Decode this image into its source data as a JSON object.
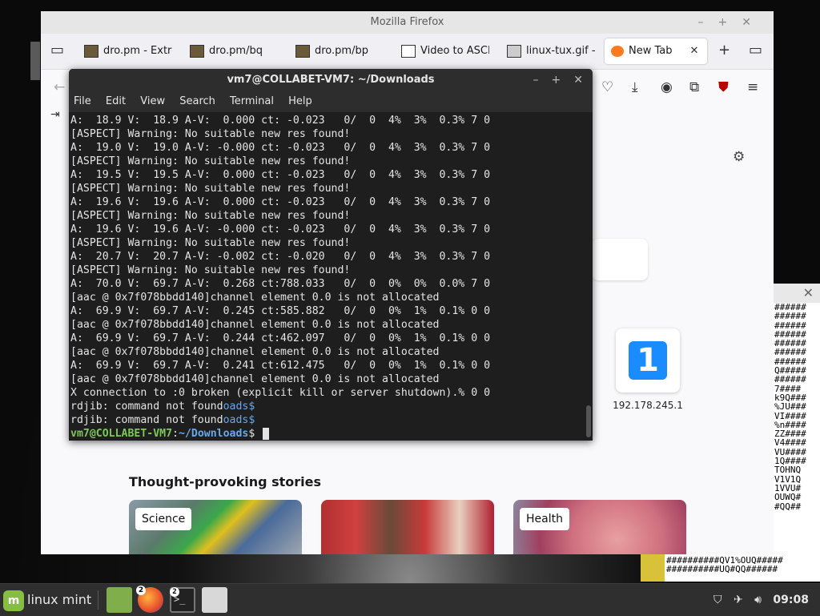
{
  "firefox": {
    "window_title": "Mozilla Firefox",
    "tabs": [
      {
        "label": "dro.pm - Extre"
      },
      {
        "label": "dro.pm/bq"
      },
      {
        "label": "dro.pm/bp"
      },
      {
        "label": "Video to ASCII"
      },
      {
        "label": "linux-tux.gif - C"
      },
      {
        "label": "New Tab"
      }
    ],
    "shortcut_label": "192.178.245.1",
    "stories_title": "Thought-provoking stories",
    "stories": [
      {
        "tag": "Science"
      },
      {
        "tag": ""
      },
      {
        "tag": "Health"
      }
    ]
  },
  "terminal": {
    "title": "vm7@COLLABET-VM7: ~/Downloads",
    "menu": [
      "File",
      "Edit",
      "View",
      "Search",
      "Terminal",
      "Help"
    ],
    "lines": [
      "A:  18.9 V:  18.9 A-V:  0.000 ct: -0.023   0/  0  4%  3%  0.3% 7 0",
      "[ASPECT] Warning: No suitable new res found!",
      "A:  19.0 V:  19.0 A-V: -0.000 ct: -0.023   0/  0  4%  3%  0.3% 7 0",
      "[ASPECT] Warning: No suitable new res found!",
      "A:  19.5 V:  19.5 A-V:  0.000 ct: -0.023   0/  0  4%  3%  0.3% 7 0",
      "[ASPECT] Warning: No suitable new res found!",
      "A:  19.6 V:  19.6 A-V:  0.000 ct: -0.023   0/  0  4%  3%  0.3% 7 0",
      "[ASPECT] Warning: No suitable new res found!",
      "A:  19.6 V:  19.6 A-V: -0.000 ct: -0.023   0/  0  4%  3%  0.3% 7 0",
      "[ASPECT] Warning: No suitable new res found!",
      "A:  20.7 V:  20.7 A-V: -0.002 ct: -0.020   0/  0  4%  3%  0.3% 7 0",
      "[ASPECT] Warning: No suitable new res found!",
      "A:  70.0 V:  69.7 A-V:  0.268 ct:788.033   0/  0  0%  0%  0.0% 7 0",
      "[aac @ 0x7f078bbdd140]channel element 0.0 is not allocated",
      "A:  69.9 V:  69.7 A-V:  0.245 ct:585.882   0/  0  0%  1%  0.1% 0 0",
      "[aac @ 0x7f078bbdd140]channel element 0.0 is not allocated",
      "A:  69.9 V:  69.7 A-V:  0.244 ct:462.097   0/  0  0%  1%  0.1% 0 0",
      "[aac @ 0x7f078bbdd140]channel element 0.0 is not allocated",
      "A:  69.9 V:  69.7 A-V:  0.241 ct:612.475   0/  0  0%  1%  0.1% 0 0",
      "[aac @ 0x7f078bbdd140]channel element 0.0 is not allocated",
      "X connection to :0 broken (explicit kill or server shutdown).% 0 0"
    ],
    "line_rdjib_1": "rdjib: command not found",
    "line_rdjib_1_tail": "oads$",
    "line_rdjib_2": "rdjib: command not found",
    "line_rdjib_2_tail": "oads$",
    "prompt_user": "vm7@COLLABET-VM7",
    "prompt_sep": ":",
    "prompt_path": "~/Downloads",
    "prompt_end": "$ "
  },
  "ascii_art": {
    "right_lines": [
      "######",
      "######",
      "######",
      "######",
      "######",
      "######",
      "######",
      "Q#####",
      "######",
      "7####",
      "k9Q###",
      "%JU###",
      "VI####",
      "%n####",
      "ZZ####",
      "V4####",
      "VU####",
      "1Q####",
      "TOHNQ",
      "V1V1Q",
      "1VVU#",
      "OUWQ#",
      "#QQ##"
    ],
    "bottom_lines": [
      "##########QV1%OUQ#####",
      "##########UQ#QQ######"
    ]
  },
  "taskbar": {
    "menu_label": "linux mint",
    "firefox_badge": "2",
    "terminal_badge": "2",
    "terminal_glyph": ">_",
    "clock": "09:08"
  }
}
